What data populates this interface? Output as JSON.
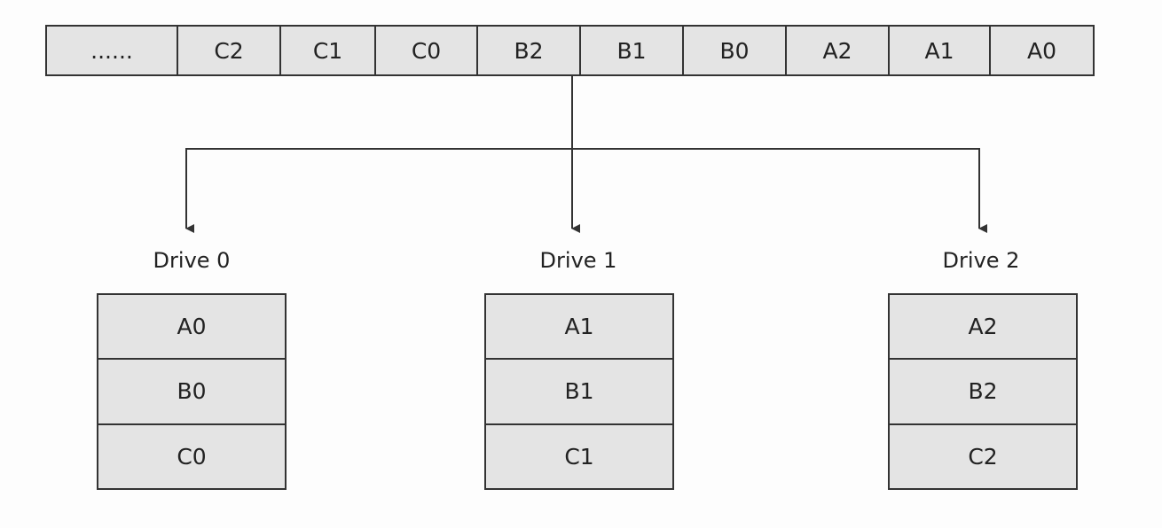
{
  "stripe": [
    "......",
    "C2",
    "C1",
    "C0",
    "B2",
    "B1",
    "B0",
    "A2",
    "A1",
    "A0"
  ],
  "drives": [
    {
      "label": "Drive 0",
      "blocks": [
        "A0",
        "B0",
        "C0"
      ]
    },
    {
      "label": "Drive 1",
      "blocks": [
        "A1",
        "B1",
        "C1"
      ]
    },
    {
      "label": "Drive 2",
      "blocks": [
        "A2",
        "B2",
        "C2"
      ]
    }
  ],
  "colors": {
    "cell_fill": "#e4e4e4",
    "line": "#333333"
  }
}
